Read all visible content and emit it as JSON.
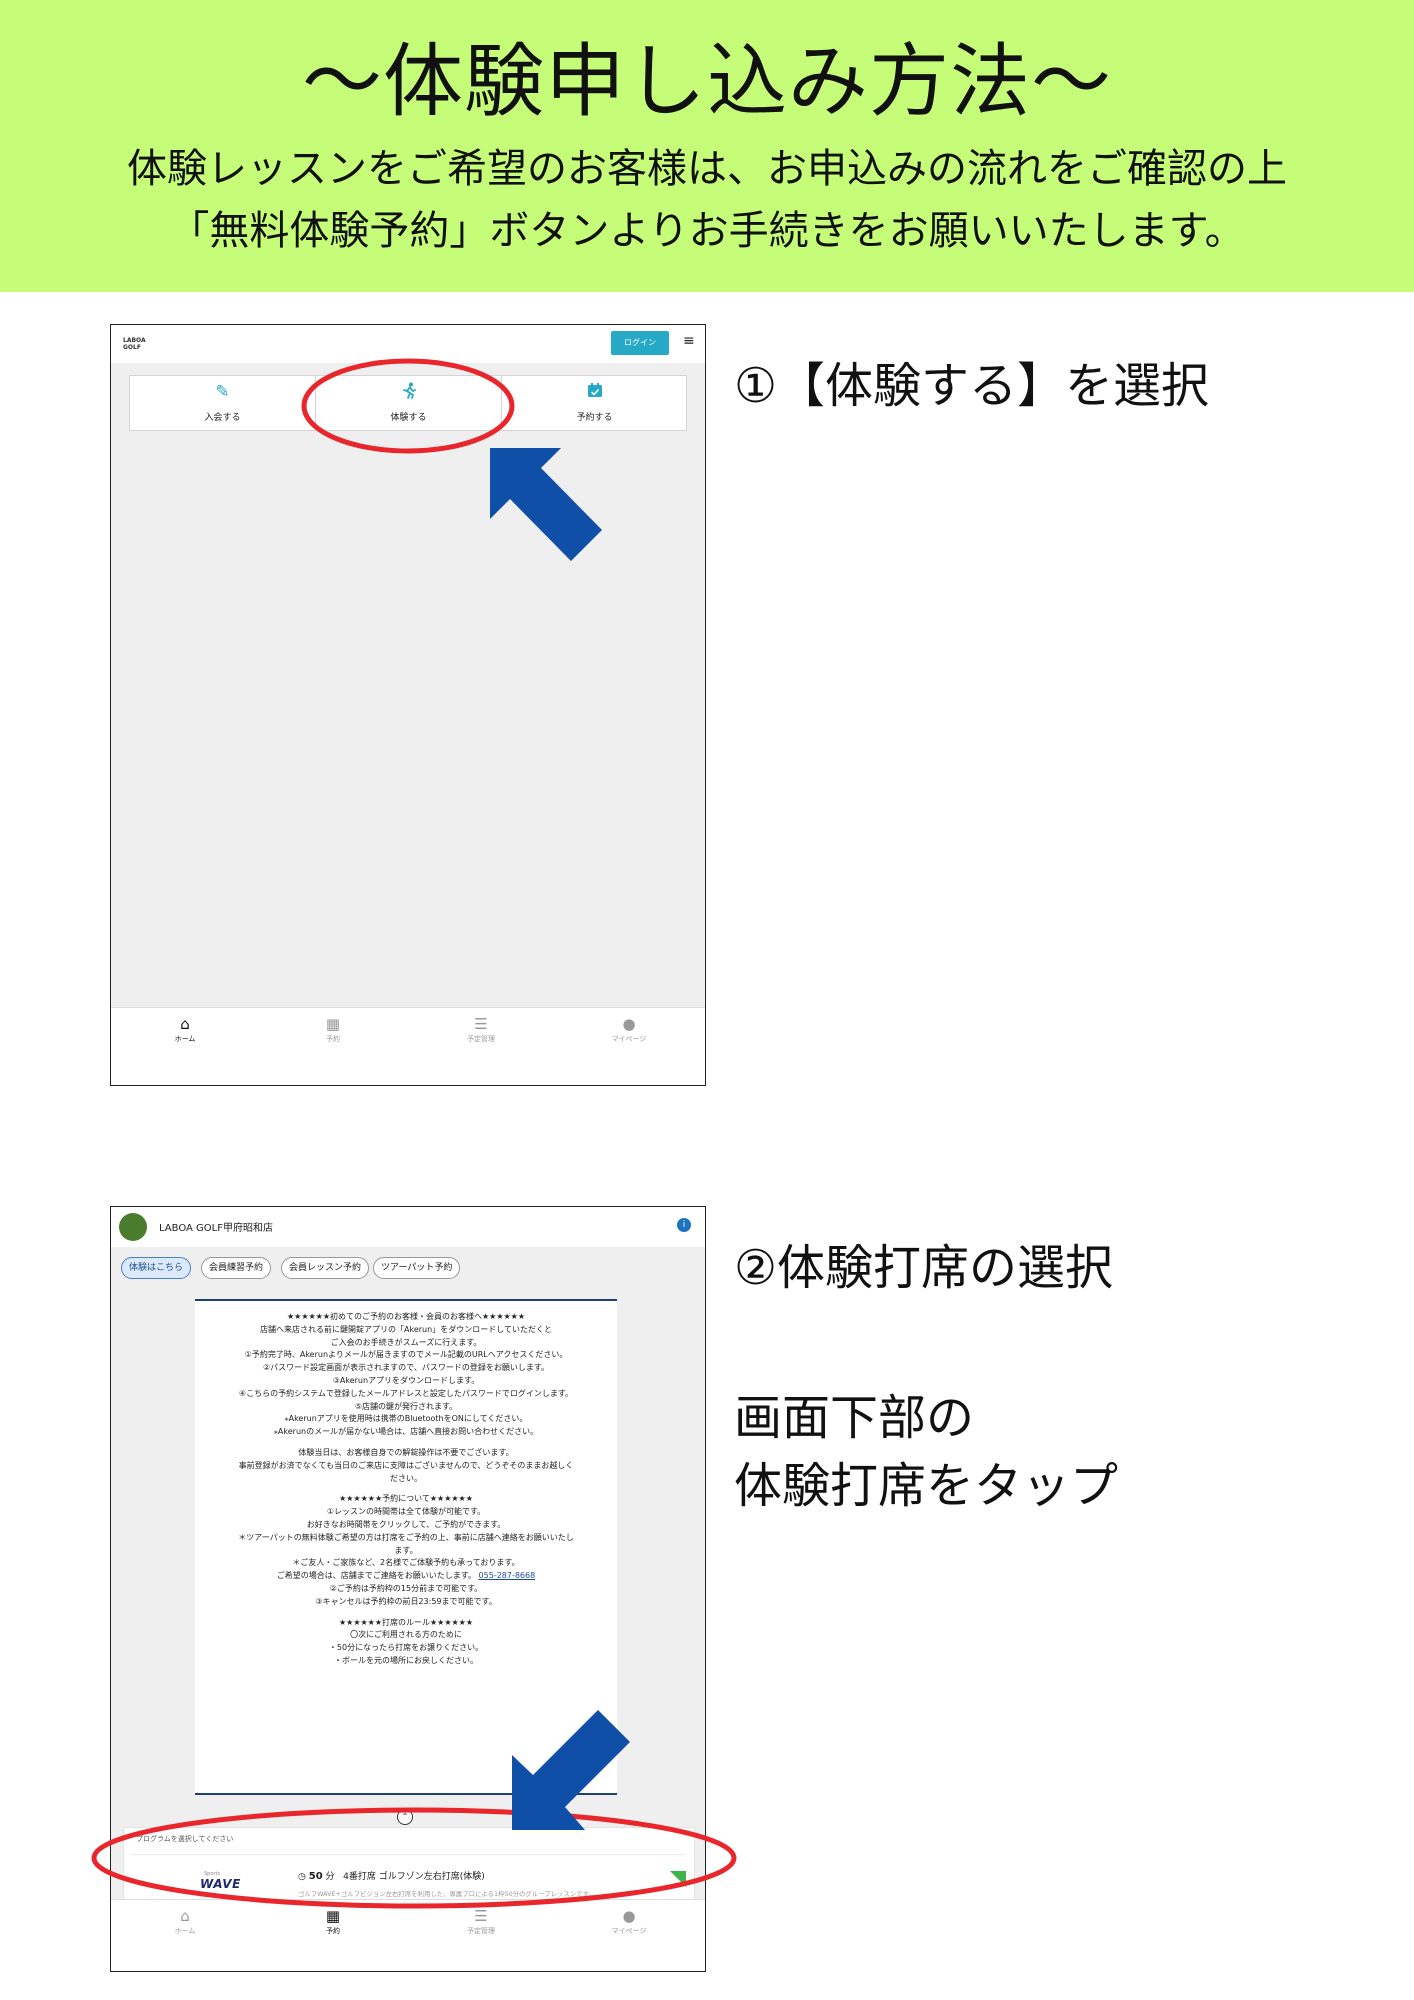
{
  "banner": {
    "title": "～体験申し込み方法～",
    "line1": "体験レッスンをご希望のお客様は、お申込みの流れをご確認の上",
    "line2": "「無料体験予約」ボタンよりお手続きをお願いいたします。"
  },
  "step1": {
    "caption": "①【体験する】を選択",
    "app": {
      "logo_line1": "LABOA",
      "logo_line2": "GOLF",
      "login_label": "ログイン",
      "menu_icon": "hamburger-icon",
      "cards": [
        {
          "label": "入会する",
          "icon": "pencil-icon"
        },
        {
          "label": "体験する",
          "icon": "running-person-icon"
        },
        {
          "label": "予約する",
          "icon": "calendar-check-icon"
        }
      ],
      "nav": [
        {
          "label": "ホーム",
          "icon": "home-icon",
          "active": true
        },
        {
          "label": "予約",
          "icon": "calendar-icon",
          "active": false
        },
        {
          "label": "予定管理",
          "icon": "list-icon",
          "active": false
        },
        {
          "label": "マイページ",
          "icon": "user-icon",
          "active": false
        }
      ]
    }
  },
  "step2": {
    "caption1": "②体験打席の選択",
    "caption2": "画面下部の",
    "caption3": "体験打席をタップ",
    "app": {
      "store_name": "LABOA GOLF甲府昭和店",
      "info_icon": "info-icon",
      "chips": [
        {
          "label": "体験はこちら",
          "active": true
        },
        {
          "label": "会員練習予約",
          "active": false
        },
        {
          "label": "会員レッスン予約",
          "active": false
        },
        {
          "label": "ツアーパット予約",
          "active": false
        }
      ],
      "notice": [
        "★★★★★★初めてのご予約のお客様・会員のお客様へ★★★★★★",
        "店舗へ来店される前に鍵開錠アプリの「Akerun」をダウンロードしていただくと",
        "ご入会のお手続きがスムーズに行えます。",
        "①予約完了時、Akerunよりメールが届きますのでメール記載のURLへアクセスください。",
        "②パスワード設定画面が表示されますので、パスワードの登録をお願いします。",
        "③Akerunアプリをダウンロードします。",
        "④こちらの予約システムで登録したメールアドレスと設定したパスワードでログインします。",
        "⑤店舗の鍵が発行されます。",
        "⁎Akerunアプリを使用時は携帯のBluetoothをONにしてください。",
        "⁎Akerunのメールが届かない場合は、店舗へ直接お問い合わせください。",
        "",
        "体験当日は、お客様自身での解錠操作は不要でございます。",
        "事前登録がお済でなくても当日のご来店に支障はございませんので、どうぞそのままお越しく",
        "ださい。",
        "",
        "★★★★★★予約について★★★★★★",
        "①レッスンの時間帯は全て体験が可能です。",
        "お好きなお時間帯をクリックして、ご予約ができます。",
        "＊ツアーパットの無料体験ご希望の方は打席をご予約の上、事前に店舗へ連絡をお願いいたし",
        "ます。",
        "＊ご友人・ご家族など、2名様でご体験予約も承っております。",
        "ご希望の場合は、店舗までご連絡をお願いいたします。",
        "②ご予約は予約枠の15分前まで可能です。",
        "③キャンセルは予約枠の前日23:59まで可能です。",
        "",
        "★★★★★★打席のルール★★★★★★",
        "〇次にご利用される方のために",
        "・50分になったら打席をお譲りください。",
        "・ボールを元の場所にお戻しください。"
      ],
      "phone": "055-287-8668",
      "program_heading": "プログラムを選択してください",
      "program": {
        "logo": "WAVE",
        "logo_sub": "Sports",
        "duration": "50",
        "duration_unit": "分",
        "title": "4番打席 ゴルフゾン左右打席(体験)",
        "desc": "ゴルフWAVE+ゴルフビジョン左右打席を利用した、専属プロによる1枠50分のグループレッスンです。",
        "clock_icon": "clock-icon"
      },
      "nav": [
        {
          "label": "ホーム",
          "icon": "home-icon",
          "active": false
        },
        {
          "label": "予約",
          "icon": "calendar-icon",
          "active": true
        },
        {
          "label": "予定管理",
          "icon": "list-icon",
          "active": false
        },
        {
          "label": "マイページ",
          "icon": "user-icon",
          "active": false
        }
      ]
    }
  },
  "colors": {
    "banner_bg": "#c6fd78",
    "accent": "#26a8c7",
    "highlight_circle": "#e8262b",
    "arrow": "#0f4fa8"
  }
}
